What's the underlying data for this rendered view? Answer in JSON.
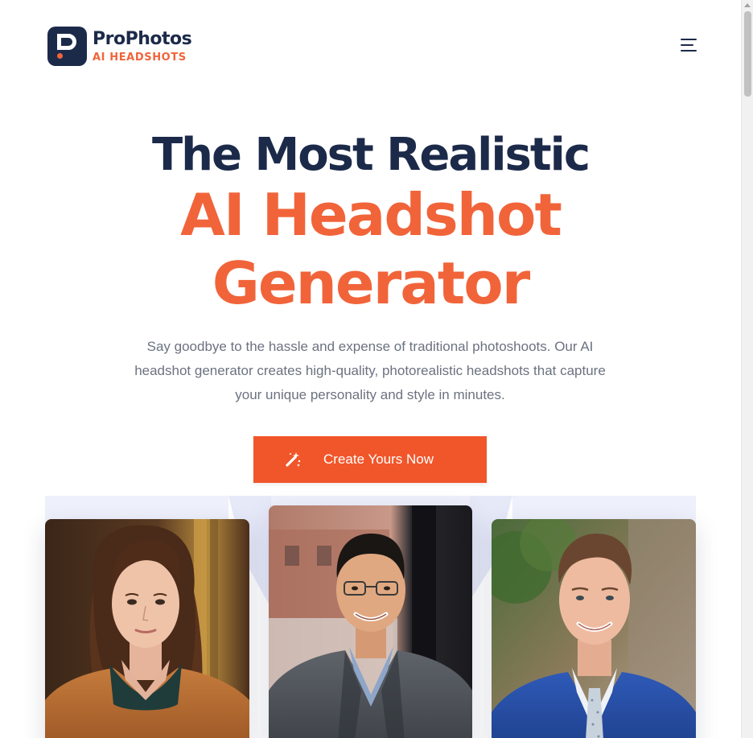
{
  "brand": {
    "name": "ProPhotos",
    "tagline": "AI HEADSHOTS",
    "colors": {
      "navy": "#1c2a4a",
      "accent": "#f1643a"
    }
  },
  "header": {
    "menu_icon": "hamburger-menu-icon"
  },
  "hero": {
    "title_line1": "The Most Realistic",
    "title_line2": "AI Headshot",
    "title_line3": "Generator",
    "subtitle": "Say goodbye to the hassle and expense of traditional photoshoots. Our AI headshot generator creates high-quality, photorealistic headshots that capture your unique personality and style in minutes.",
    "cta_label": "Create Yours Now",
    "cta_icon": "magic-wand-icon"
  },
  "gallery": {
    "photos": [
      {
        "icon": "headshot-woman-brown-coat"
      },
      {
        "icon": "headshot-man-gray-jacket-glasses"
      },
      {
        "icon": "headshot-man-blue-suit"
      }
    ]
  }
}
